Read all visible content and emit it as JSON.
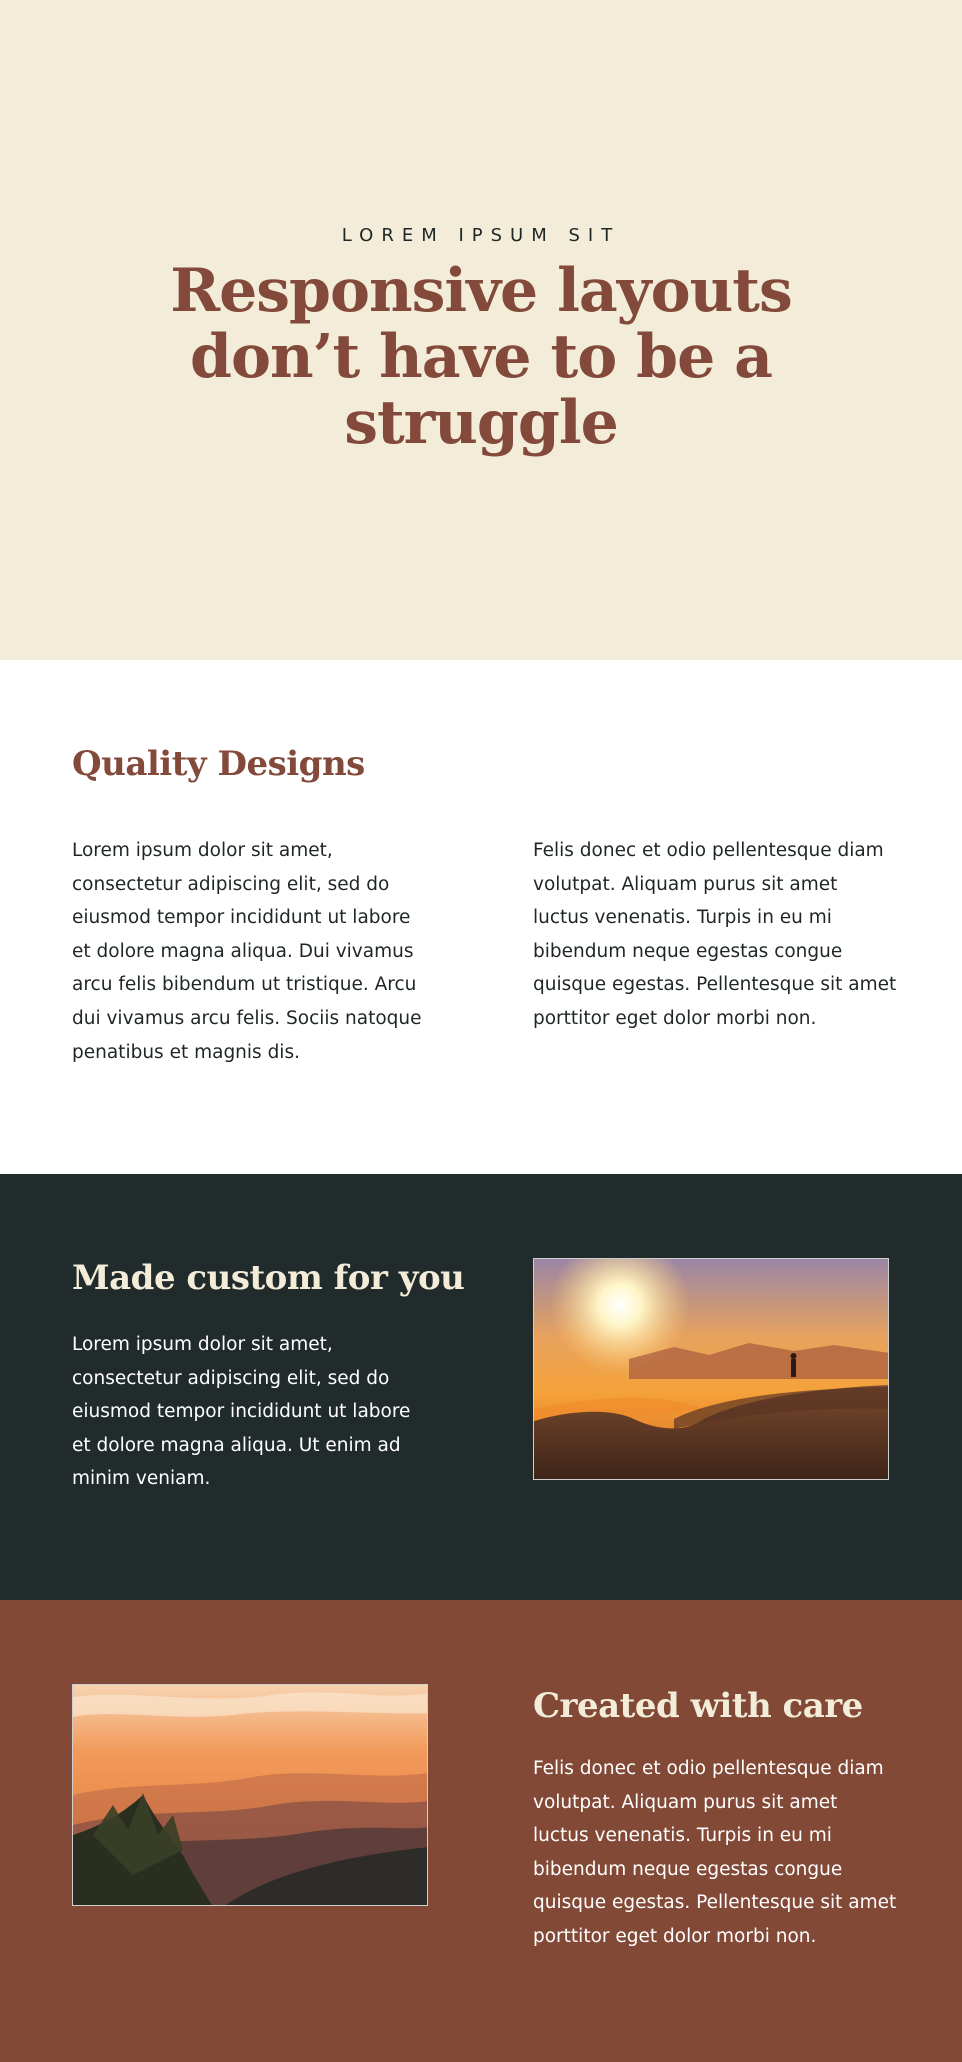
{
  "hero": {
    "eyebrow": "LOREM IPSUM SIT",
    "title": "Responsive layouts don’t have to be a struggle"
  },
  "quality": {
    "title": "Quality Designs",
    "left_text": "Lorem ipsum dolor sit amet, consectetur adipiscing elit, sed do eiusmod tempor incididunt ut labore et dolore magna aliqua. Dui vivamus arcu felis bibendum ut tristique. Arcu dui vivamus arcu felis. Sociis natoque penatibus et magnis dis.",
    "right_text": "Felis donec et odio pellentesque diam volutpat. Aliquam purus sit amet luctus venenatis. Turpis in eu mi bibendum neque egestas congue quisque egestas. Pellentesque sit amet porttitor eget dolor morbi non."
  },
  "custom": {
    "title": "Made custom for you",
    "text": "Lorem ipsum dolor sit amet, consectetur adipiscing elit, sed do eiusmod tempor incididunt ut labore et dolore magna aliqua. Ut enim ad minim veniam."
  },
  "care": {
    "title": "Created with care",
    "text": "Felis donec et odio pellentesque diam volutpat. Aliquam purus sit amet luctus venenatis. Turpis in eu mi bibendum neque egestas congue quisque egestas. Pellentesque sit amet porttitor eget dolor morbi non."
  },
  "colors": {
    "hero_bg": "#f2ecd9",
    "accent": "#83493a",
    "dark_bg": "#222b2b",
    "care_bg": "#834937",
    "cream_text": "#f2ecd9"
  }
}
